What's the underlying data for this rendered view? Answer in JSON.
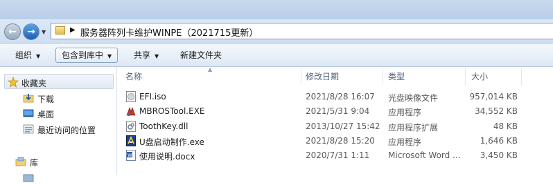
{
  "address": {
    "path": "服务器阵列卡维护WINPE（2021715更新）"
  },
  "toolbar": {
    "organize": "组织",
    "include_in_library": "包含到库中",
    "share": "共享",
    "new_folder": "新建文件夹"
  },
  "nav": {
    "favorites": "收藏夹",
    "downloads": "下载",
    "desktop": "桌面",
    "recent": "最近访问的位置",
    "libraries": "库"
  },
  "columns": {
    "name": "名称",
    "date": "修改日期",
    "type": "类型",
    "size": "大小"
  },
  "files": [
    {
      "name": "EFI.iso",
      "date": "2021/8/28 16:07",
      "type": "光盘映像文件",
      "size": "957,014 KB",
      "icon": "disc-image-icon"
    },
    {
      "name": "MBROSTool.EXE",
      "date": "2021/5/31 9:04",
      "type": "应用程序",
      "size": "34,552 KB",
      "icon": "tool-exe-icon"
    },
    {
      "name": "ToothKey.dll",
      "date": "2013/10/27 15:42",
      "type": "应用程序扩展",
      "size": "48 KB",
      "icon": "dll-icon"
    },
    {
      "name": "U盘启动制作.exe",
      "date": "2021/8/28 15:20",
      "type": "应用程序",
      "size": "1,646 KB",
      "icon": "usb-exe-icon"
    },
    {
      "name": "使用说明.docx",
      "date": "2020/7/31 1:11",
      "type": "Microsoft Word ...",
      "size": "3,450 KB",
      "icon": "word-doc-icon"
    }
  ]
}
